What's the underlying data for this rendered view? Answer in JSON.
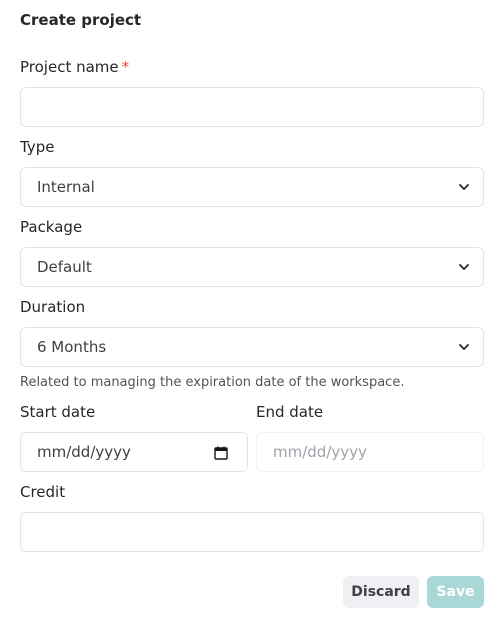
{
  "form": {
    "title": "Create project",
    "project_name": {
      "label": "Project name",
      "required_mark": "*",
      "value": ""
    },
    "type": {
      "label": "Type",
      "value": "Internal"
    },
    "package": {
      "label": "Package",
      "value": "Default"
    },
    "duration": {
      "label": "Duration",
      "value": "6 Months",
      "hint": "Related to managing the expiration date of the workspace."
    },
    "start_date": {
      "label": "Start date",
      "placeholder": "mm/dd/yyyy"
    },
    "end_date": {
      "label": "End date",
      "placeholder": "mm/dd/yyyy",
      "disabled": true
    },
    "credit": {
      "label": "Credit",
      "value": ""
    }
  },
  "actions": {
    "discard_label": "Discard",
    "save_label": "Save",
    "save_disabled": true
  },
  "icons": {
    "select_indicator": "chevron-down-icon",
    "date_picker": "calendar-icon"
  },
  "colors": {
    "required": "#ef4444",
    "save_disabled_bg": "#a9d8d6",
    "discard_bg": "#eef0f3"
  }
}
